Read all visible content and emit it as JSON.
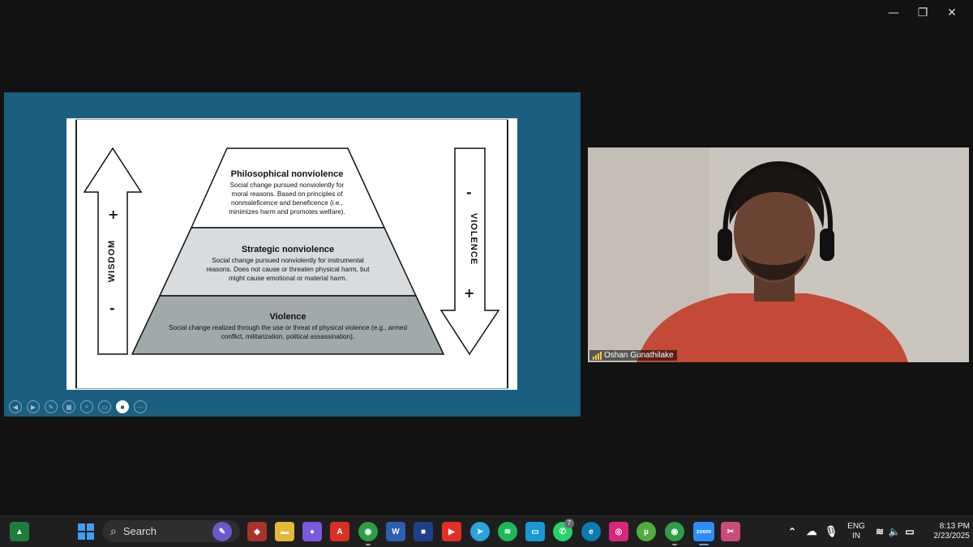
{
  "window_controls": {
    "minimize": "—",
    "restore": "❐",
    "close": "✕"
  },
  "slide": {
    "tiers": [
      {
        "title": "Philosophical nonviolence",
        "desc": [
          "Social change pursued nonviolently for",
          "moral reasons. Based on principles of",
          "nonmaleficence and beneficence (i.e.,",
          "minimizes harm and promotes welfare)."
        ]
      },
      {
        "title": "Strategic nonviolence",
        "desc": [
          "Social change pursued nonviolently for instrumental",
          "reasons. Does not cause or threaten physical harm, but",
          "might cause emotional or material harm."
        ]
      },
      {
        "title": "Violence",
        "desc": [
          "Social change realized through the use or threat of physical violence (e.g., armed",
          "conflict, militarization, political assassination)."
        ]
      }
    ],
    "left_arrow": {
      "label": "WISDOM",
      "top_sign": "+",
      "bottom_sign": "-"
    },
    "right_arrow": {
      "label": "VIOLENCE",
      "top_sign": "-",
      "bottom_sign": "+"
    }
  },
  "participant": {
    "name": "Oshan Gunathilake"
  },
  "taskbar": {
    "search_label": "Search",
    "lang_top": "ENG",
    "lang_bottom": "IN",
    "time": "8:13 PM",
    "date": "2/23/2025",
    "whatsapp_badge": "7",
    "zoom_label": "zoom"
  },
  "colors": {
    "share_bg": "#1b5f80",
    "tier1": "#ffffff",
    "tier2": "#d9dcdf",
    "tier3": "#a2a9ab",
    "shirt": "#c24a36"
  }
}
